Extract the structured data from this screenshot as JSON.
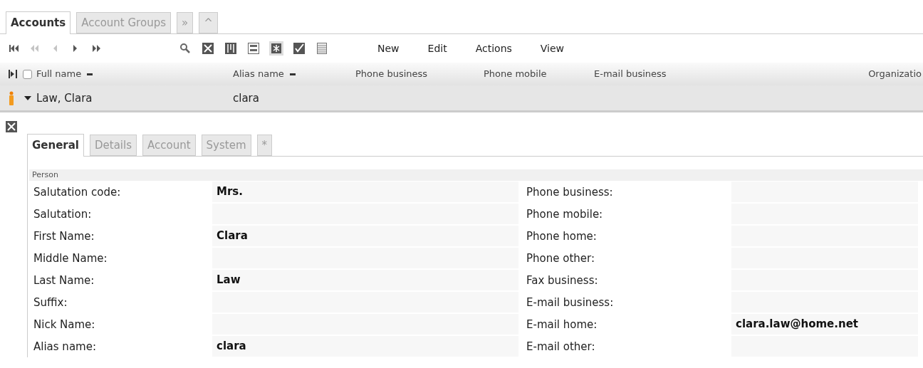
{
  "tabs": [
    {
      "label": "Accounts",
      "selected": true
    },
    {
      "label": "Account Groups",
      "selected": false
    },
    {
      "label": "»",
      "selected": false
    },
    {
      "label": "^",
      "selected": false
    }
  ],
  "navigation": [
    {
      "kind": "first",
      "disabled": false
    },
    {
      "kind": "prev_page",
      "disabled": true
    },
    {
      "kind": "prev",
      "disabled": true
    },
    {
      "kind": "next",
      "disabled": false
    },
    {
      "kind": "last",
      "disabled": false
    }
  ],
  "tools": [
    {
      "kind": "close",
      "selected": false
    },
    {
      "kind": "columns",
      "selected": false
    },
    {
      "kind": "form",
      "selected": false
    },
    {
      "kind": "star",
      "selected": true
    },
    {
      "kind": "check",
      "selected": false
    },
    {
      "kind": "list",
      "selected": false
    }
  ],
  "menu": [
    "New",
    "Edit",
    "Actions",
    "View"
  ],
  "table": {
    "select_all_checked": false,
    "columns": [
      {
        "label": "Full name",
        "sortable": true
      },
      {
        "label": "Alias name",
        "sortable": true
      },
      {
        "label": "Phone business",
        "sortable": false
      },
      {
        "label": "Phone mobile",
        "sortable": false
      },
      {
        "label": "E-mail business",
        "sortable": false
      },
      {
        "label": "Organizatio",
        "sortable": false
      }
    ],
    "rows": [
      {
        "expanded": true,
        "cells": [
          "Law, Clara",
          "clara"
        ]
      }
    ]
  },
  "detail": {
    "tabs": [
      {
        "label": "General",
        "selected": true
      },
      {
        "label": "Details",
        "selected": false
      },
      {
        "label": "Account",
        "selected": false
      },
      {
        "label": "System",
        "selected": false
      },
      {
        "label": "*",
        "selected": false
      }
    ],
    "section": "Person",
    "left_fields": [
      {
        "label": "Salutation code:",
        "value": "Mrs."
      },
      {
        "label": "Salutation:"
      },
      {
        "label": "First Name:",
        "value": "Clara"
      },
      {
        "label": "Middle Name:"
      },
      {
        "label": "Last Name:",
        "value": "Law"
      },
      {
        "label": "Suffix:"
      },
      {
        "label": "Nick Name:"
      },
      {
        "label": "Alias name:",
        "value": "clara"
      }
    ],
    "right_fields": [
      {
        "label": "Phone business:"
      },
      {
        "label": "Phone mobile:"
      },
      {
        "label": "Phone home:"
      },
      {
        "label": "Phone other:"
      },
      {
        "label": "Fax business:"
      },
      {
        "label": "E-mail business:"
      },
      {
        "label": "E-mail home:",
        "value": "clara.law@home.net"
      },
      {
        "label": "E-mail other:"
      }
    ]
  }
}
